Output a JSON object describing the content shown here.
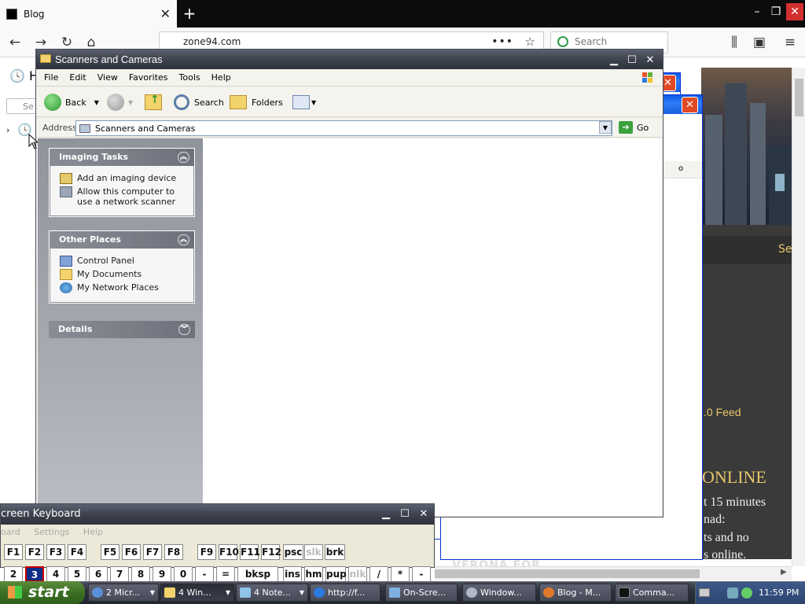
{
  "browser": {
    "tab_title": "Blog",
    "url": "zone94.com",
    "search_placeholder": "Search",
    "page_text": {
      "se": "Se",
      "feed": ".0 Feed",
      "online": "ONLINE",
      "line1": "t 15 minutes",
      "line2": "nad:",
      "line3": "ts and no",
      "line4": "s online.",
      "sidebar_h": "H",
      "sidebar_search": "Se",
      "bottom_partial": "VERONA FOR"
    }
  },
  "behind_window": {
    "partial_text": "o"
  },
  "explorer": {
    "title": "Scanners and Cameras",
    "menu": [
      "File",
      "Edit",
      "View",
      "Favorites",
      "Tools",
      "Help"
    ],
    "toolbar": {
      "back": "Back",
      "search": "Search",
      "folders": "Folders"
    },
    "address": {
      "label": "Address",
      "value": "Scanners and Cameras",
      "go": "Go"
    },
    "panels": {
      "imaging": {
        "title": "Imaging Tasks",
        "items": [
          "Add an imaging device",
          "Allow this computer to use a network scanner"
        ]
      },
      "other": {
        "title": "Other Places",
        "items": [
          "Control Panel",
          "My Documents",
          "My Network Places"
        ]
      },
      "details": {
        "title": "Details"
      }
    }
  },
  "osk": {
    "title": "creen Keyboard",
    "menu": [
      "oard",
      "Settings",
      "Help"
    ],
    "row1": [
      "F1",
      "F2",
      "F3",
      "F4",
      "F5",
      "F6",
      "F7",
      "F8",
      "F9",
      "F10",
      "F11",
      "F12",
      "psc",
      "slk",
      "brk"
    ],
    "row2": [
      "2",
      "3",
      "4",
      "5",
      "6",
      "7",
      "8",
      "9",
      "0",
      "-",
      "=",
      "bksp",
      "ins",
      "hm",
      "pup",
      "nlk",
      "/",
      "*",
      "-"
    ]
  },
  "taskbar": {
    "start": "start",
    "tasks": [
      {
        "label": "2 Micr..."
      },
      {
        "label": "4 Win..."
      },
      {
        "label": "4 Note..."
      },
      {
        "label": "http://f..."
      },
      {
        "label": "On-Scre..."
      },
      {
        "label": "Window..."
      },
      {
        "label": "Blog - M..."
      },
      {
        "label": "Comma..."
      }
    ],
    "clock": "11:59 PM"
  },
  "colors": {
    "xp_blue": "#0a58e2",
    "close_red": "#e04a24",
    "go_green": "#3da23d"
  }
}
